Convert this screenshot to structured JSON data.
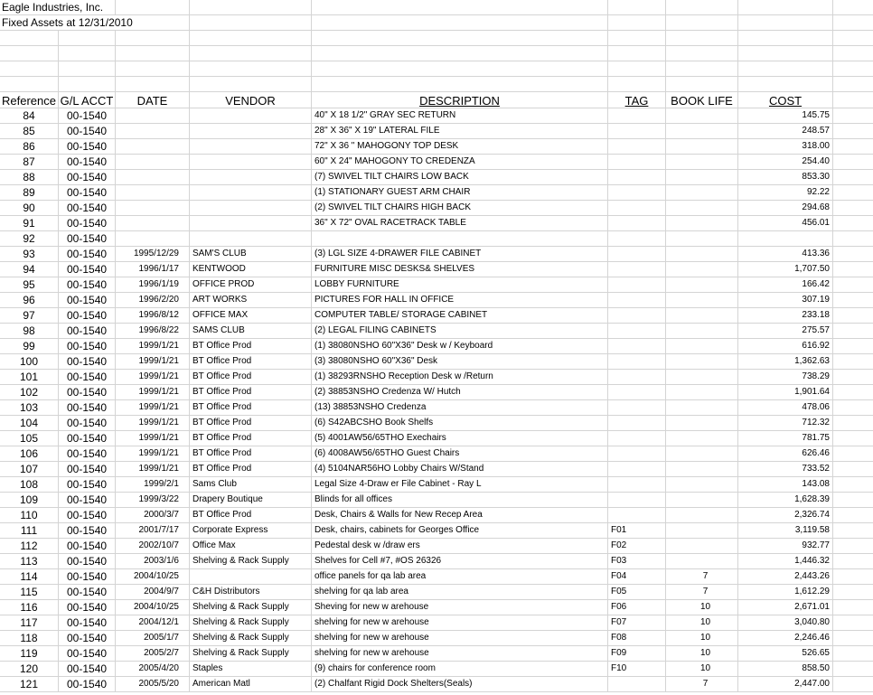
{
  "company": "Eagle Industries, Inc.",
  "sheet_title": "Fixed Assets at 12/31/2010",
  "headers": {
    "reference": "Reference",
    "gl_acct": "G/L ACCT",
    "date": "DATE",
    "vendor": "VENDOR",
    "description": "DESCRIPTION",
    "tag": "TAG",
    "book_life": "BOOK LIFE",
    "cost": "COST"
  },
  "rows": [
    {
      "ref": "84",
      "acct": "00-1540",
      "date": "",
      "vendor": "",
      "description": "40\" X 18 1/2\" GRAY SEC RETURN",
      "tag": "",
      "life": "",
      "cost": "145.75"
    },
    {
      "ref": "85",
      "acct": "00-1540",
      "date": "",
      "vendor": "",
      "description": "28\" X 36\" X 19\" LATERAL FILE",
      "tag": "",
      "life": "",
      "cost": "248.57"
    },
    {
      "ref": "86",
      "acct": "00-1540",
      "date": "",
      "vendor": "",
      "description": "72\" X 36 \" MAHOGONY TOP DESK",
      "tag": "",
      "life": "",
      "cost": "318.00"
    },
    {
      "ref": "87",
      "acct": "00-1540",
      "date": "",
      "vendor": "",
      "description": "60\" X 24\" MAHOGONY TO CREDENZA",
      "tag": "",
      "life": "",
      "cost": "254.40"
    },
    {
      "ref": "88",
      "acct": "00-1540",
      "date": "",
      "vendor": "",
      "description": "(7) SWIVEL TILT CHAIRS LOW BACK",
      "tag": "",
      "life": "",
      "cost": "853.30"
    },
    {
      "ref": "89",
      "acct": "00-1540",
      "date": "",
      "vendor": "",
      "description": "(1) STATIONARY GUEST ARM CHAIR",
      "tag": "",
      "life": "",
      "cost": "92.22"
    },
    {
      "ref": "90",
      "acct": "00-1540",
      "date": "",
      "vendor": "",
      "description": "(2) SWIVEL TILT CHAIRS HIGH BACK",
      "tag": "",
      "life": "",
      "cost": "294.68"
    },
    {
      "ref": "91",
      "acct": "00-1540",
      "date": "",
      "vendor": "",
      "description": "36\" X 72\" OVAL RACETRACK TABLE",
      "tag": "",
      "life": "",
      "cost": "456.01"
    },
    {
      "ref": "92",
      "acct": "00-1540",
      "date": "",
      "vendor": "",
      "description": "",
      "tag": "",
      "life": "",
      "cost": ""
    },
    {
      "ref": "93",
      "acct": "00-1540",
      "date": "1995/12/29",
      "vendor": "SAM'S CLUB",
      "description": "(3) LGL SIZE 4-DRAWER FILE CABINET",
      "tag": "",
      "life": "",
      "cost": "413.36"
    },
    {
      "ref": "94",
      "acct": "00-1540",
      "date": "1996/1/17",
      "vendor": "KENTWOOD",
      "description": "FURNITURE MISC DESKS& SHELVES",
      "tag": "",
      "life": "",
      "cost": "1,707.50"
    },
    {
      "ref": "95",
      "acct": "00-1540",
      "date": "1996/1/19",
      "vendor": "OFFICE PROD",
      "description": "LOBBY FURNITURE",
      "tag": "",
      "life": "",
      "cost": "166.42"
    },
    {
      "ref": "96",
      "acct": "00-1540",
      "date": "1996/2/20",
      "vendor": "ART WORKS",
      "description": "PICTURES FOR HALL IN OFFICE",
      "tag": "",
      "life": "",
      "cost": "307.19"
    },
    {
      "ref": "97",
      "acct": "00-1540",
      "date": "1996/8/12",
      "vendor": "OFFICE MAX",
      "description": "COMPUTER TABLE/ STORAGE CABINET",
      "tag": "",
      "life": "",
      "cost": "233.18"
    },
    {
      "ref": "98",
      "acct": "00-1540",
      "date": "1996/8/22",
      "vendor": "SAMS CLUB",
      "description": "(2) LEGAL FILING CABINETS",
      "tag": "",
      "life": "",
      "cost": "275.57"
    },
    {
      "ref": "99",
      "acct": "00-1540",
      "date": "1999/1/21",
      "vendor": "BT Office Prod",
      "description": "(1) 38080NSHO 60\"X36\" Desk w / Keyboard",
      "tag": "",
      "life": "",
      "cost": "616.92"
    },
    {
      "ref": "100",
      "acct": "00-1540",
      "date": "1999/1/21",
      "vendor": "BT Office Prod",
      "description": "(3) 38080NSHO 60\"X36\" Desk",
      "tag": "",
      "life": "",
      "cost": "1,362.63"
    },
    {
      "ref": "101",
      "acct": "00-1540",
      "date": "1999/1/21",
      "vendor": "BT Office Prod",
      "description": "(1) 38293RNSHO Reception Desk w /Return",
      "tag": "",
      "life": "",
      "cost": "738.29"
    },
    {
      "ref": "102",
      "acct": "00-1540",
      "date": "1999/1/21",
      "vendor": "BT Office Prod",
      "description": "(2) 38853NSHO Credenza W/ Hutch",
      "tag": "",
      "life": "",
      "cost": "1,901.64"
    },
    {
      "ref": "103",
      "acct": "00-1540",
      "date": "1999/1/21",
      "vendor": "BT Office Prod",
      "description": "(13) 38853NSHO Credenza",
      "tag": "",
      "life": "",
      "cost": "478.06"
    },
    {
      "ref": "104",
      "acct": "00-1540",
      "date": "1999/1/21",
      "vendor": "BT Office Prod",
      "description": "(6) S42ABCSHO Book Shelfs",
      "tag": "",
      "life": "",
      "cost": "712.32"
    },
    {
      "ref": "105",
      "acct": "00-1540",
      "date": "1999/1/21",
      "vendor": "BT Office Prod",
      "description": "(5) 4001AW56/65THO Exechairs",
      "tag": "",
      "life": "",
      "cost": "781.75"
    },
    {
      "ref": "106",
      "acct": "00-1540",
      "date": "1999/1/21",
      "vendor": "BT Office Prod",
      "description": "(6) 4008AW56/65THO Guest Chairs",
      "tag": "",
      "life": "",
      "cost": "626.46"
    },
    {
      "ref": "107",
      "acct": "00-1540",
      "date": "1999/1/21",
      "vendor": "BT Office Prod",
      "description": "(4) 5104NAR56HO Lobby Chairs W/Stand",
      "tag": "",
      "life": "",
      "cost": "733.52"
    },
    {
      "ref": "108",
      "acct": "00-1540",
      "date": "1999/2/1",
      "vendor": "Sams Club",
      "description": "Legal Size 4-Draw er File Cabinet - Ray L",
      "tag": "",
      "life": "",
      "cost": "143.08"
    },
    {
      "ref": "109",
      "acct": "00-1540",
      "date": "1999/3/22",
      "vendor": "Drapery Boutique",
      "description": "Blinds for all offices",
      "tag": "",
      "life": "",
      "cost": "1,628.39"
    },
    {
      "ref": "110",
      "acct": "00-1540",
      "date": "2000/3/7",
      "vendor": "BT Office Prod",
      "description": "Desk, Chairs & Walls for New Recep Area",
      "tag": "",
      "life": "",
      "cost": "2,326.74"
    },
    {
      "ref": "111",
      "acct": "00-1540",
      "date": "2001/7/17",
      "vendor": "Corporate Express",
      "description": "Desk, chairs, cabinets for Georges Office",
      "tag": "F01",
      "life": "",
      "cost": "3,119.58"
    },
    {
      "ref": "112",
      "acct": "00-1540",
      "date": "2002/10/7",
      "vendor": "Office Max",
      "description": "Pedestal desk w /draw ers",
      "tag": "F02",
      "life": "",
      "cost": "932.77"
    },
    {
      "ref": "113",
      "acct": "00-1540",
      "date": "2003/1/6",
      "vendor": "Shelving & Rack Supply",
      "description": "Shelves for Cell #7, #OS 26326",
      "tag": "F03",
      "life": "",
      "cost": "1,446.32"
    },
    {
      "ref": "114",
      "acct": "00-1540",
      "date": "2004/10/25",
      "vendor": "",
      "description": "office panels for qa lab area",
      "tag": "F04",
      "life": "7",
      "cost": "2,443.26"
    },
    {
      "ref": "115",
      "acct": "00-1540",
      "date": "2004/9/7",
      "vendor": "C&H Distributors",
      "description": "shelving for qa lab area",
      "tag": "F05",
      "life": "7",
      "cost": "1,612.29"
    },
    {
      "ref": "116",
      "acct": "00-1540",
      "date": "2004/10/25",
      "vendor": "Shelving & Rack Supply",
      "description": "Sheving for new w arehouse",
      "tag": "F06",
      "life": "10",
      "cost": "2,671.01"
    },
    {
      "ref": "117",
      "acct": "00-1540",
      "date": "2004/12/1",
      "vendor": "Shelving & Rack Supply",
      "description": "shelving for new w arehouse",
      "tag": "F07",
      "life": "10",
      "cost": "3,040.80"
    },
    {
      "ref": "118",
      "acct": "00-1540",
      "date": "2005/1/7",
      "vendor": "Shelving & Rack Supply",
      "description": "shelving for new w arehouse",
      "tag": "F08",
      "life": "10",
      "cost": "2,246.46"
    },
    {
      "ref": "119",
      "acct": "00-1540",
      "date": "2005/2/7",
      "vendor": "Shelving & Rack Supply",
      "description": "shelving for new w arehouse",
      "tag": "F09",
      "life": "10",
      "cost": "526.65"
    },
    {
      "ref": "120",
      "acct": "00-1540",
      "date": "2005/4/20",
      "vendor": "Staples",
      "description": "(9) chairs for conference room",
      "tag": "F10",
      "life": "10",
      "cost": "858.50"
    },
    {
      "ref": "121",
      "acct": "00-1540",
      "date": "2005/5/20",
      "vendor": "American Matl",
      "description": "(2) Chalfant Rigid Dock Shelters(Seals)",
      "tag": "",
      "life": "7",
      "cost": "2,447.00"
    }
  ]
}
